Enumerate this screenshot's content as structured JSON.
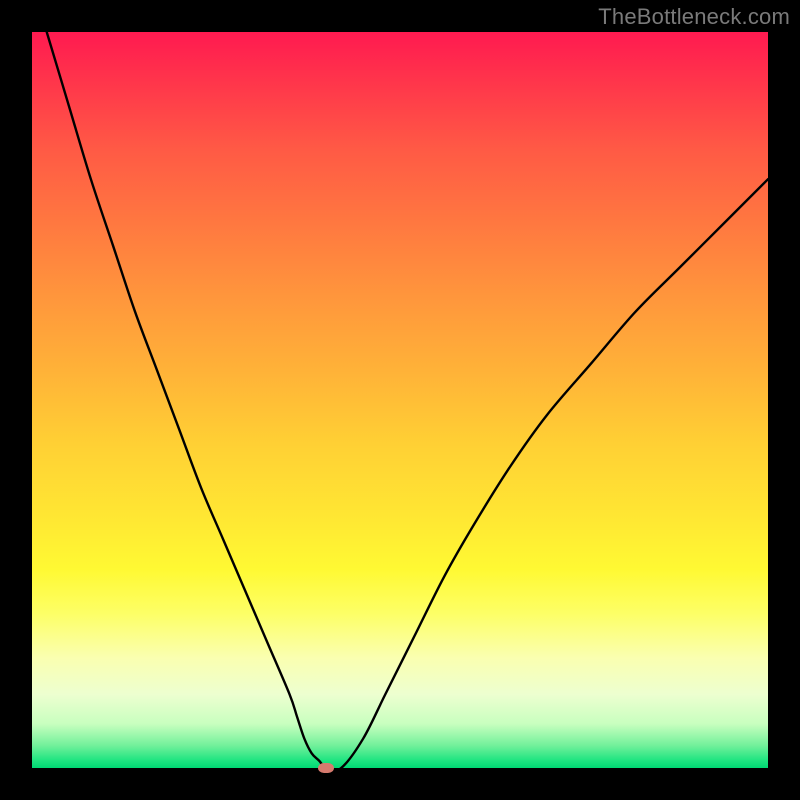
{
  "watermark": "TheBottleneck.com",
  "colors": {
    "frame": "#000000",
    "curve": "#000000",
    "marker": "#d67a6e",
    "watermark": "#7a7a7a"
  },
  "chart_data": {
    "type": "line",
    "title": "",
    "xlabel": "",
    "ylabel": "",
    "xlim": [
      0,
      100
    ],
    "ylim": [
      0,
      100
    ],
    "grid": false,
    "legend": false,
    "annotations": [],
    "series": [
      {
        "name": "curve",
        "x": [
          2,
          5,
          8,
          11,
          14,
          17,
          20,
          23,
          26,
          29,
          32,
          35,
          36,
          37,
          38,
          39,
          40,
          42,
          45,
          48,
          52,
          56,
          60,
          65,
          70,
          76,
          82,
          88,
          94,
          100
        ],
        "values": [
          100,
          90,
          80,
          71,
          62,
          54,
          46,
          38,
          31,
          24,
          17,
          10,
          7,
          4,
          2,
          1,
          0,
          0,
          4,
          10,
          18,
          26,
          33,
          41,
          48,
          55,
          62,
          68,
          74,
          80
        ]
      }
    ],
    "marker": {
      "x": 40,
      "y": 0
    }
  }
}
